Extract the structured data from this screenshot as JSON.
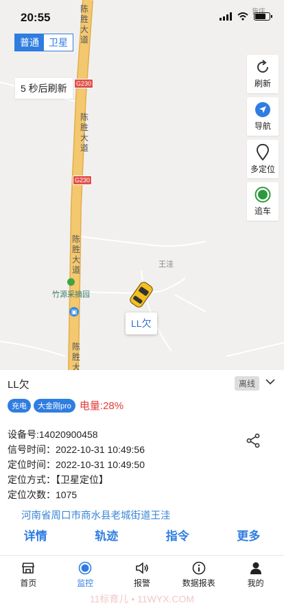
{
  "status_bar": {
    "time": "20:55",
    "battery_level": 0.85
  },
  "map": {
    "type_toggle": {
      "normal": "普通",
      "satellite": "卫星"
    },
    "refresh_note": "5 秒后刷新",
    "tools": [
      {
        "label": "刷新",
        "icon": "refresh-icon"
      },
      {
        "label": "导航",
        "icon": "navigation-icon"
      },
      {
        "label": "多定位",
        "icon": "location-pin-icon"
      },
      {
        "label": "追车",
        "icon": "track-target-icon"
      }
    ],
    "road_name": "陈胜大道",
    "road_name_bottom": "陈胜大",
    "highway_shield": "G230",
    "poi_orchard": "竹源采摘园",
    "poi_village": "王洼",
    "car_label": "LL欠",
    "watermark_top": "皆庄",
    "colors": {
      "road": "#f3c86f",
      "road_edge": "#e2ad4d",
      "shield": "#e0504a",
      "car": "#f4c021"
    }
  },
  "panel": {
    "device_name": "LL欠",
    "status": "离线",
    "tags": [
      "充电",
      "大金刚pro"
    ],
    "battery": "电量:28%",
    "info": {
      "device_no": "设备号:14020900458",
      "signal_time": "信号时间：2022-10-31 10:49:56",
      "locate_time": "定位时间：2022-10-31 10:49:50",
      "locate_method": "定位方式：【卫星定位】",
      "locate_count": "定位次数：1075"
    },
    "address": "河南省周口市商水县老城街道王洼",
    "actions": [
      "详情",
      "轨迹",
      "指令",
      "更多"
    ]
  },
  "tabbar": {
    "items": [
      {
        "label": "首页",
        "icon": "store-icon"
      },
      {
        "label": "监控",
        "icon": "monitor-icon"
      },
      {
        "label": "报警",
        "icon": "speaker-icon"
      },
      {
        "label": "数据报表",
        "icon": "info-icon"
      },
      {
        "label": "我的",
        "icon": "user-icon"
      }
    ],
    "active": "监控"
  },
  "watermark": "11标育儿 • 11WYX.COM"
}
